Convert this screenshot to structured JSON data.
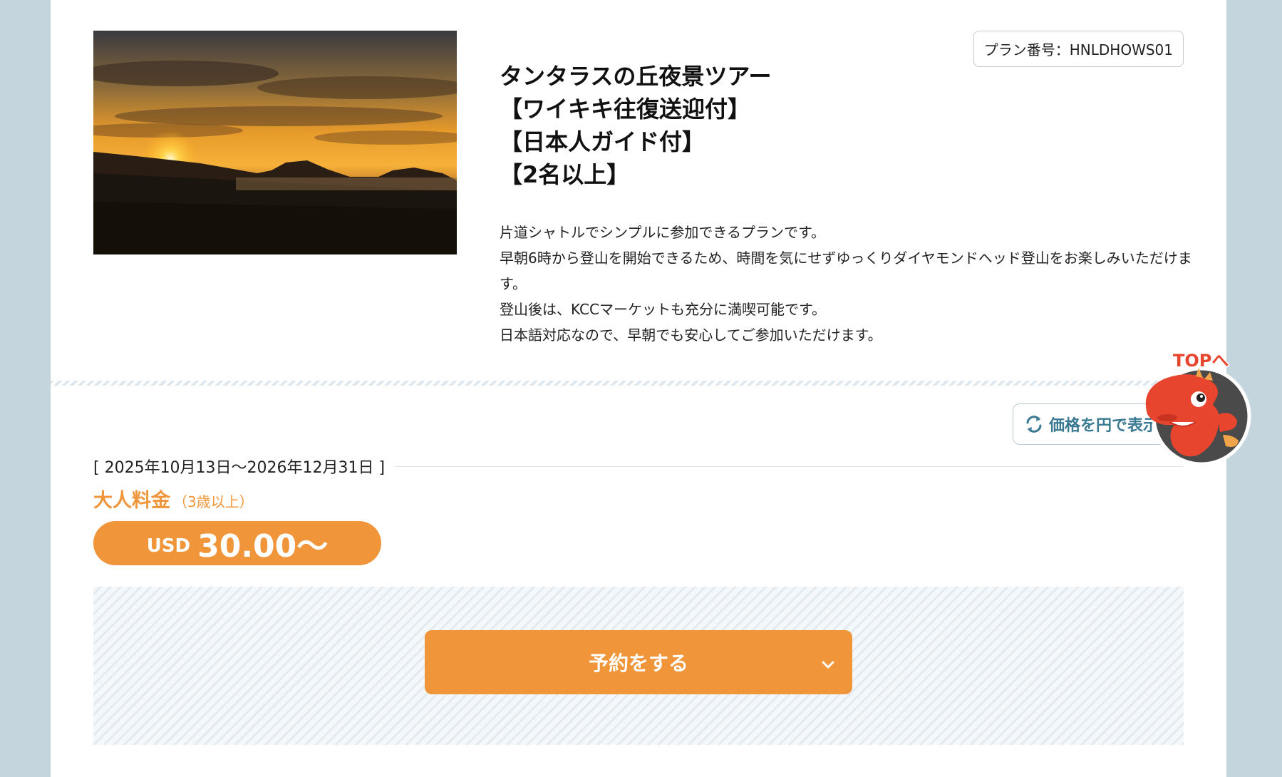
{
  "plan": {
    "number_label": "プラン番号：HNLDHOWS01",
    "title_lines": [
      "タンタラスの丘夜景ツアー",
      "【ワイキキ往復送迎付】",
      "【日本人ガイド付】",
      "【2名以上】"
    ],
    "description": [
      "片道シャトルでシンプルに参加できるプランです。",
      "早朝6時から登山を開始できるため、時間を気にせずゆっくりダイヤモンドヘッド登山をお楽しみいただけます。",
      "登山後は、KCCマーケットも充分に満喫可能です。",
      "日本語対応なので、早朝でも安心してご参加いただけます。"
    ],
    "photo_icon": "sunset-photo"
  },
  "pricing": {
    "yen_toggle_label": "価格を円で表示",
    "yen_toggle_icon": "refresh-icon",
    "period": "[ 2025年10月13日～2026年12月31日 ]",
    "adult_label": "大人料金",
    "adult_age": "（3歳以上）",
    "currency": "USD",
    "price": "30.00～"
  },
  "reserve": {
    "button_label": "予約をする",
    "icon": "chevron-down-icon"
  },
  "scroll_top": {
    "label": "TOPへ",
    "icon": "dinosaur-mascot-icon"
  },
  "colors": {
    "accent": "#f0953a",
    "page_bg": "#c5d5de",
    "link": "#3b7a93",
    "mascot": "#e8452f"
  }
}
